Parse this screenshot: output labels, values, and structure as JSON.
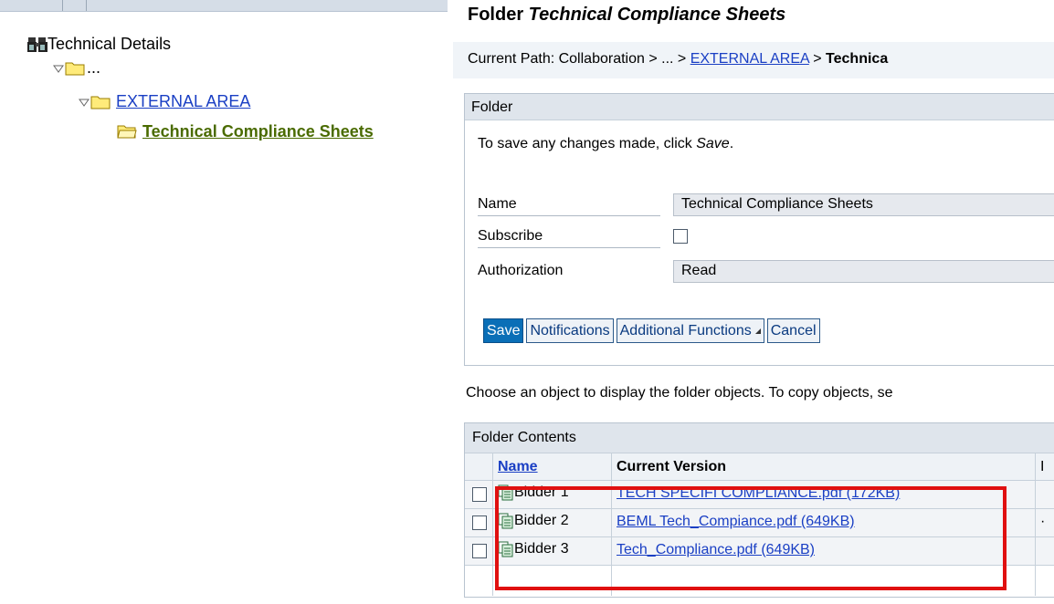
{
  "tree": {
    "root_label": "Technical Details",
    "ellipsis_node": "...",
    "external_area": "EXTERNAL AREA",
    "current_folder": "Technical Compliance Sheets"
  },
  "page": {
    "title_prefix": "Folder ",
    "title_name": "Technical Compliance Sheets",
    "breadcrumb_prefix": "Current Path:  Collaboration > ... > ",
    "breadcrumb_link": "EXTERNAL AREA",
    "breadcrumb_sep": " > ",
    "breadcrumb_current": "Technica"
  },
  "folder_panel": {
    "header": "Folder",
    "hint_prefix": "To save any changes made, click ",
    "hint_italic": "Save",
    "hint_suffix": ".",
    "name_label": "Name",
    "name_value": "Technical Compliance Sheets",
    "subscribe_label": "Subscribe",
    "auth_label": "Authorization",
    "auth_value": "Read",
    "buttons": {
      "save": "Save",
      "notifications": "Notifications",
      "additional": "Additional Functions",
      "cancel": "Cancel"
    }
  },
  "contents": {
    "instruction": "Choose an object to display the folder objects. To copy objects, se",
    "title": "Folder Contents",
    "col_name": "Name",
    "col_version": "Current Version",
    "col_extra": "I",
    "rows": [
      {
        "name": "Bidder 1",
        "version": "TECH SPECIFI COMPLIANCE.pdf (172KB)",
        "extra": ""
      },
      {
        "name": "Bidder 2",
        "version": "BEML Tech_Compiance.pdf (649KB)",
        "extra": "·"
      },
      {
        "name": "Bidder 3",
        "version": "Tech_Compliance.pdf (649KB)",
        "extra": ""
      }
    ]
  },
  "colors": {
    "link": "#1a3fc4",
    "current_folder": "#4a6b00",
    "primary_button": "#0a6fb7",
    "annotation": "#e01010"
  }
}
